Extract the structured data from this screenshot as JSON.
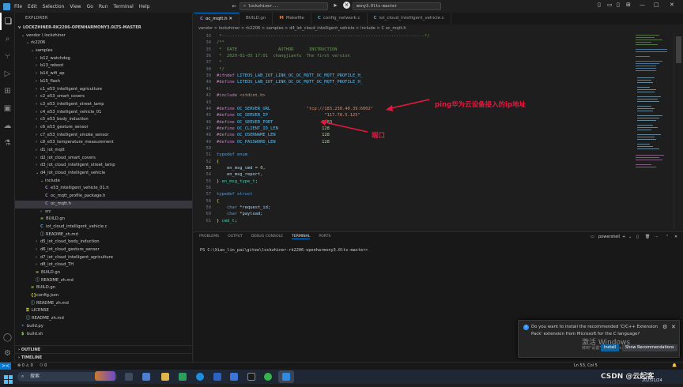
{
  "titlebar": {
    "menus": [
      "File",
      "Edit",
      "Selection",
      "View",
      "Go",
      "Run",
      "Terminal",
      "Help"
    ],
    "search1": "lockzhiner...",
    "search2": "mony3.0lts-master",
    "min": "—",
    "max": "□",
    "close": "✕"
  },
  "explorer": {
    "title": "EXPLORER",
    "root": "LOCKZHINER-RK2206-OPENHARMONY3.0LTS-MASTER",
    "tree": [
      {
        "depth": 0,
        "chev": "v",
        "label": "vendor \\ lockzhiner",
        "kind": "folder"
      },
      {
        "depth": 1,
        "chev": "v",
        "label": "rk2206",
        "kind": "folder"
      },
      {
        "depth": 2,
        "chev": "v",
        "label": "samples",
        "kind": "folder"
      },
      {
        "depth": 3,
        "chev": ">",
        "label": "b12_watchdog",
        "kind": "folder"
      },
      {
        "depth": 3,
        "chev": ">",
        "label": "b13_reboot",
        "kind": "folder"
      },
      {
        "depth": 3,
        "chev": ">",
        "label": "b14_wifi_ap",
        "kind": "folder"
      },
      {
        "depth": 3,
        "chev": ">",
        "label": "b15_flash",
        "kind": "folder"
      },
      {
        "depth": 3,
        "chev": ">",
        "label": "c1_e53_intelligent_agriculture",
        "kind": "folder"
      },
      {
        "depth": 3,
        "chev": ">",
        "label": "c2_e53_smart_covers",
        "kind": "folder"
      },
      {
        "depth": 3,
        "chev": ">",
        "label": "c3_e53_intelligent_street_lamp",
        "kind": "folder"
      },
      {
        "depth": 3,
        "chev": ">",
        "label": "c4_e53_intelligent_vehicle_01",
        "kind": "folder"
      },
      {
        "depth": 3,
        "chev": ">",
        "label": "c5_e53_body_induction",
        "kind": "folder"
      },
      {
        "depth": 3,
        "chev": ">",
        "label": "c6_e53_gesture_sensor",
        "kind": "folder"
      },
      {
        "depth": 3,
        "chev": ">",
        "label": "c7_e53_intelligent_smoke_sensor",
        "kind": "folder"
      },
      {
        "depth": 3,
        "chev": ">",
        "label": "c8_e53_temperature_measurement",
        "kind": "folder"
      },
      {
        "depth": 3,
        "chev": ">",
        "label": "d1_iot_mqtt",
        "kind": "folder"
      },
      {
        "depth": 3,
        "chev": ">",
        "label": "d2_iot_cloud_smart_covers",
        "kind": "folder"
      },
      {
        "depth": 3,
        "chev": ">",
        "label": "d3_iot_cloud_intelligent_street_lamp",
        "kind": "folder"
      },
      {
        "depth": 3,
        "chev": "v",
        "label": "d4_iot_cloud_intelligent_vehicle",
        "kind": "folder"
      },
      {
        "depth": 4,
        "chev": "v",
        "label": "include",
        "kind": "folder"
      },
      {
        "depth": 5,
        "chev": "",
        "label": "e53_intelligent_vehicle_01.h",
        "kind": "h"
      },
      {
        "depth": 5,
        "chev": "",
        "label": "oc_mqtt_profile_package.h",
        "kind": "h"
      },
      {
        "depth": 5,
        "chev": "",
        "label": "oc_mqtt.h",
        "kind": "h",
        "selected": true
      },
      {
        "depth": 4,
        "chev": ">",
        "label": "src",
        "kind": "folder"
      },
      {
        "depth": 4,
        "chev": "",
        "label": "BUILD.gn",
        "kind": "gn"
      },
      {
        "depth": 4,
        "chev": "",
        "label": "iot_cloud_intelligent_vehicle.c",
        "kind": "c"
      },
      {
        "depth": 4,
        "chev": "",
        "label": "README_zh.md",
        "kind": "md"
      },
      {
        "depth": 3,
        "chev": ">",
        "label": "d5_iot_cloud_body_induction",
        "kind": "folder"
      },
      {
        "depth": 3,
        "chev": ">",
        "label": "d6_iot_cloud_gesture_sensor",
        "kind": "folder"
      },
      {
        "depth": 3,
        "chev": ">",
        "label": "d7_iot_cloud_intelligent_agriculture",
        "kind": "folder"
      },
      {
        "depth": 3,
        "chev": ">",
        "label": "d8_iot_cloud_TH",
        "kind": "folder"
      },
      {
        "depth": 3,
        "chev": "",
        "label": "BUILD.gn",
        "kind": "gn"
      },
      {
        "depth": 3,
        "chev": "",
        "label": "README_zh.md",
        "kind": "md"
      },
      {
        "depth": 2,
        "chev": "",
        "label": "BUILD.gn",
        "kind": "gn"
      },
      {
        "depth": 2,
        "chev": "",
        "label": "config.json",
        "kind": "json"
      },
      {
        "depth": 2,
        "chev": "",
        "label": "README_zh.md",
        "kind": "md"
      },
      {
        "depth": 1,
        "chev": "",
        "label": "LICENSE",
        "kind": "lic"
      },
      {
        "depth": 1,
        "chev": "",
        "label": "README_zh.md",
        "kind": "md"
      },
      {
        "depth": 0,
        "chev": "",
        "label": "build.py",
        "kind": "py"
      },
      {
        "depth": 0,
        "chev": "",
        "label": "build.sh",
        "kind": "sh"
      }
    ],
    "outline": "OUTLINE",
    "timeline": "TIMELINE"
  },
  "tabs": [
    {
      "icon": "C",
      "label": "oc_mqtt.h",
      "active": true,
      "color": "#a074c4"
    },
    {
      "icon": "",
      "label": "BUILD.gn",
      "active": false,
      "color": "#cccccc"
    },
    {
      "icon": "M",
      "label": "Makefile",
      "active": false,
      "color": "#e37933"
    },
    {
      "icon": "C",
      "label": "config_network.c",
      "active": false,
      "color": "#519aba"
    },
    {
      "icon": "C",
      "label": "iot_cloud_intelligent_vehicle.c",
      "active": false,
      "color": "#519aba"
    }
  ],
  "breadcrumb": "vendor > lockzhiner > rk2206 > samples > d4_iot_cloud_intelligent_vehicle > include > C oc_mqtt.h",
  "code": [
    {
      "n": "33",
      "t": [
        [
          "c-com",
          " *-------------------------------------------------------------------------------*/"
        ]
      ]
    },
    {
      "n": "34",
      "t": [
        [
          "c-com",
          "/**"
        ]
      ]
    },
    {
      "n": "35",
      "t": [
        [
          "c-com",
          " *  DATE                AUTHOR      INSTRUCTION"
        ]
      ]
    },
    {
      "n": "36",
      "t": [
        [
          "c-com",
          " *  2020-02-05 17:01  changjianfu  The first version"
        ]
      ]
    },
    {
      "n": "37",
      "t": [
        [
          "c-com",
          " *"
        ]
      ]
    },
    {
      "n": "38",
      "t": [
        [
          "c-com",
          " */"
        ]
      ]
    },
    {
      "n": "39",
      "t": [
        [
          "c-pp",
          "#ifndef"
        ],
        [
          "c-mac",
          " LITEOS_LAB_IOT_LINK_OC_OC_MQTT_OC_MQTT_PROFILE_H_"
        ]
      ]
    },
    {
      "n": "40",
      "t": [
        [
          "c-pp",
          "#define"
        ],
        [
          "c-mac",
          " LITEOS_LAB_IOT_LINK_OC_OC_MQTT_OC_MQTT_PROFILE_H_"
        ]
      ]
    },
    {
      "n": "41",
      "t": [
        [
          "",
          ""
        ]
      ]
    },
    {
      "n": "42",
      "t": [
        [
          "c-pp",
          "#include"
        ],
        [
          "c-str",
          " <stdint.h>"
        ]
      ]
    },
    {
      "n": "43",
      "t": [
        [
          "",
          ""
        ]
      ]
    },
    {
      "n": "44",
      "t": [
        [
          "c-pp",
          "#define"
        ],
        [
          "c-mac",
          " OC_SERVER_URL"
        ],
        [
          "",
          "              "
        ],
        [
          "c-str",
          "\"tcp://183.230.40.39:6002\""
        ]
      ]
    },
    {
      "n": "45",
      "t": [
        [
          "c-pp",
          "#define"
        ],
        [
          "c-mac",
          " OC_SERVER_IP"
        ],
        [
          "",
          "                      "
        ],
        [
          "c-str",
          "\"117.78.5.125\""
        ]
      ]
    },
    {
      "n": "46",
      "t": [
        [
          "c-pp",
          "#define"
        ],
        [
          "c-mac",
          " OC_SERVER_PORT"
        ],
        [
          "",
          "                   "
        ],
        [
          "c-num",
          "1883"
        ]
      ]
    },
    {
      "n": "47",
      "t": [
        [
          "c-pp",
          "#define"
        ],
        [
          "c-mac",
          " OC_CLIENT_ID_LEN"
        ],
        [
          "",
          "                 "
        ],
        [
          "c-num",
          "128"
        ]
      ]
    },
    {
      "n": "48",
      "t": [
        [
          "c-pp",
          "#define"
        ],
        [
          "c-mac",
          " OC_USERNAME_LEN"
        ],
        [
          "",
          "                  "
        ],
        [
          "c-num",
          "128"
        ]
      ]
    },
    {
      "n": "49",
      "t": [
        [
          "c-pp",
          "#define"
        ],
        [
          "c-mac",
          " OC_PASSWORD_LEN"
        ],
        [
          "",
          "                  "
        ],
        [
          "c-num",
          "128"
        ]
      ]
    },
    {
      "n": "50",
      "t": [
        [
          "",
          ""
        ]
      ]
    },
    {
      "n": "51",
      "t": [
        [
          "c-kw",
          "typedef"
        ],
        [
          "c-kw",
          " enum"
        ]
      ]
    },
    {
      "n": "52",
      "t": [
        [
          "c-br",
          "{"
        ]
      ]
    },
    {
      "n": "53",
      "t": [
        [
          "",
          "    "
        ],
        [
          "c-id",
          "en_msg_cmd"
        ],
        [
          "",
          " = "
        ],
        [
          "c-num",
          "0"
        ],
        [
          "",
          ","
        ]
      ]
    },
    {
      "n": "54",
      "t": [
        [
          "",
          "    "
        ],
        [
          "c-id",
          "en_msg_report"
        ],
        [
          "",
          ","
        ]
      ]
    },
    {
      "n": "55",
      "t": [
        [
          "c-br",
          "}"
        ],
        [
          "c-ty",
          " en_msg_type_t"
        ],
        [
          "",
          ";"
        ]
      ]
    },
    {
      "n": "56",
      "t": [
        [
          "",
          ""
        ]
      ]
    },
    {
      "n": "57",
      "t": [
        [
          "c-kw",
          "typedef"
        ],
        [
          "c-kw",
          " struct"
        ]
      ]
    },
    {
      "n": "58",
      "t": [
        [
          "c-br",
          "{"
        ]
      ]
    },
    {
      "n": "59",
      "t": [
        [
          "",
          "    "
        ],
        [
          "c-kw",
          "char"
        ],
        [
          "",
          " *"
        ],
        [
          "c-id",
          "request_id"
        ],
        [
          "",
          ";"
        ]
      ]
    },
    {
      "n": "60",
      "t": [
        [
          "",
          "    "
        ],
        [
          "c-kw",
          "char"
        ],
        [
          "",
          " *"
        ],
        [
          "c-id",
          "payload"
        ],
        [
          "",
          ";"
        ]
      ]
    },
    {
      "n": "61",
      "t": [
        [
          "c-br",
          "}"
        ],
        [
          "c-ty",
          " cmd_t"
        ],
        [
          "",
          ";"
        ]
      ]
    }
  ],
  "annotations": {
    "ip_note": "ping华为云设备接入的ip地址",
    "port_note": "端口"
  },
  "panel": {
    "tabs": [
      "PROBLEMS",
      "OUTPUT",
      "DEBUG CONSOLE",
      "TERMINAL",
      "PORTS"
    ],
    "active_tab": "TERMINAL",
    "shell": "powershell",
    "prompt": "PS C:\\Xiao_lin_pai\\gitee\\lockzhiner-rk2206-openharmony3.0lts-master>"
  },
  "notification": {
    "text_line1": "Do you want to install the recommended 'C/C++ Extension",
    "text_line2": "Pack' extension from Microsoft for the C language?",
    "install": "Install",
    "show": "Show Recommendations",
    "watermark1": "激活 Windows",
    "watermark2": "转到\"设置\"以激活 Windows。"
  },
  "statusbar": {
    "branch": "⊗ 0 ⚠ 0",
    "remote": "><",
    "cursor": "Ln 53, Col 5"
  },
  "taskbar": {
    "search": "搜索",
    "date": "2025/1/24",
    "csdn": "CSDN @云起客"
  }
}
